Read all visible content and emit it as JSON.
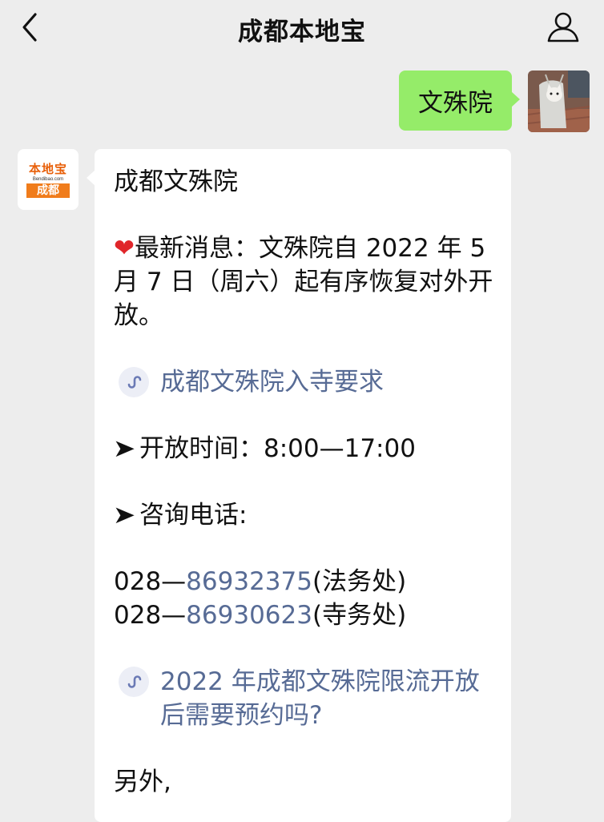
{
  "nav": {
    "title": "成都本地宝"
  },
  "user_message": {
    "text": "文殊院"
  },
  "bot": {
    "avatar": {
      "line1": "本地宝",
      "line2": "Bendibao.com",
      "line3": "成都"
    },
    "title": "成都文殊院",
    "news": {
      "heart": "❤",
      "text": "最新消息：文殊院自 2022 年 5 月 7 日（周六）起有序恢复对外开放。"
    },
    "link1": "成都文殊院入寺要求",
    "hours": {
      "arrow": "➤",
      "text": "开放时间：8:00—17:00"
    },
    "phone_heading": {
      "arrow": "➤",
      "text": "咨询电话:"
    },
    "phones": [
      {
        "prefix": "028—",
        "number": "86932375",
        "note": "(法务处)"
      },
      {
        "prefix": "028—",
        "number": "86930623",
        "note": "(寺务处)"
      }
    ],
    "link2": "2022 年成都文殊院限流开放后需要预约吗?",
    "tail": "另外,"
  },
  "colors": {
    "bg": "#ededed",
    "green_bubble": "#95ec69",
    "link": "#576b95",
    "brand_orange": "#f07c1b"
  }
}
